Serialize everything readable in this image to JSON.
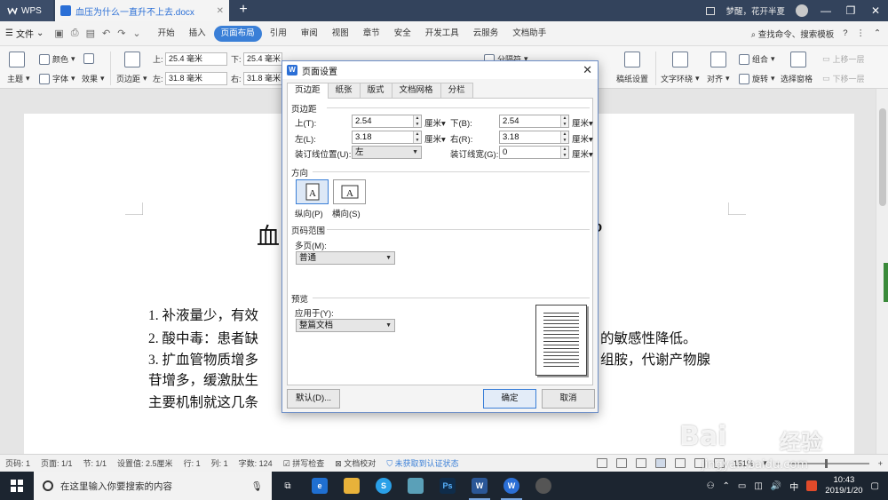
{
  "titlebar": {
    "app_name": "WPS",
    "doc_tab": "血压为什么一直升不上去.docx",
    "new_tab": "+",
    "user": "梦醒，花开半夏"
  },
  "menubar": {
    "file": "文件",
    "items": [
      "开始",
      "插入",
      "页面布局",
      "引用",
      "审阅",
      "视图",
      "章节",
      "安全",
      "开发工具",
      "云服务",
      "文档助手"
    ],
    "active": "页面布局",
    "search": "查找命令、搜索模板"
  },
  "ribbon": {
    "theme": "主题",
    "color": "颜色",
    "font": "字体",
    "effect": "效果",
    "margins": "页边距",
    "top_label": "上:",
    "top_value": "25.4 毫米",
    "bottom_label": "下:",
    "bottom_value": "25.4 毫米",
    "left_label": "左:",
    "left_value": "31.8 毫米",
    "right_label": "右:",
    "right_value": "31.8 毫米",
    "section_break": "分隔符",
    "manuscript": "稿纸设置",
    "text_wrap": "文字环绕",
    "align": "对齐",
    "group": "组合",
    "rotate": "旋转",
    "select_pane": "选择窗格",
    "bring_forward": "上移一层",
    "send_backward": "下移一层"
  },
  "document": {
    "title_start": "血",
    "title_end": "?",
    "lines": [
      "1.  补液量少，有效",
      "2.  酸中毒：患者缺",
      "3.  扩血管物质增多",
      "苷增多，缓激肽生",
      "  主要机制就这几条"
    ],
    "line2_end": "的敏感性降低。",
    "line3_end": "组胺，代谢产物腺"
  },
  "dialog": {
    "title": "页面设置",
    "tabs": [
      "页边距",
      "纸张",
      "版式",
      "文档网格",
      "分栏"
    ],
    "active_tab": "页边距",
    "margins_group": "页边距",
    "top_label": "上(T):",
    "top_value": "2.54",
    "bottom_label": "下(B):",
    "bottom_value": "2.54",
    "left_label": "左(L):",
    "left_value": "3.18",
    "right_label": "右(R):",
    "right_value": "3.18",
    "gutter_pos_label": "装订线位置(U):",
    "gutter_pos_value": "左",
    "gutter_width_label": "装订线宽(G):",
    "gutter_width_value": "0",
    "unit": "厘米",
    "orientation_group": "方向",
    "portrait": "纵向(P)",
    "landscape": "横向(S)",
    "pages_group": "页码范围",
    "multi_pages_label": "多页(M):",
    "multi_pages_value": "普通",
    "preview_group": "预览",
    "apply_to_label": "应用于(Y):",
    "apply_to_value": "整篇文档",
    "default_button": "默认(D)...",
    "ok_button": "确定",
    "cancel_button": "取消"
  },
  "statusbar": {
    "page_num": "页码: 1",
    "pages": "页面: 1/1",
    "section": "节: 1/1",
    "setting": "设置值: 2.5厘米",
    "row": "行: 1",
    "col": "列: 1",
    "word_count": "字数: 124",
    "spell_check": "拼写检查",
    "doc_proof": "文档校对",
    "auth": "未获取到认证状态",
    "zoom": "151%"
  },
  "taskbar": {
    "search_placeholder": "在这里输入你要搜索的内容",
    "time": "10:43",
    "date": "2019/1/20",
    "ime": "中"
  },
  "watermark": {
    "brand": "Bai",
    "brand_cn": "经验",
    "url": "jingyan.baidu.com"
  }
}
